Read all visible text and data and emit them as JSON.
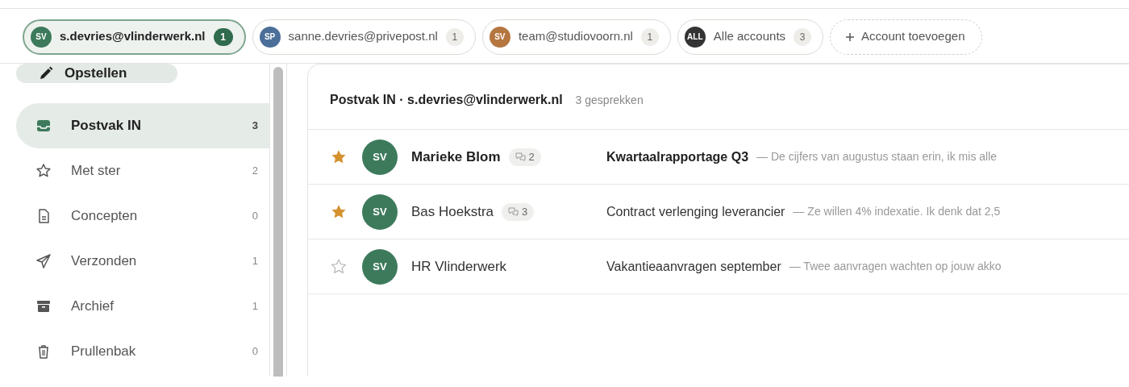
{
  "accounts": [
    {
      "initials": "SV",
      "label": "s.devries@vlinderwerk.nl",
      "count": "1",
      "color": "#3d7a5c",
      "selected": true
    },
    {
      "initials": "SP",
      "label": "sanne.devries@privepost.nl",
      "count": "1",
      "color": "#4b6f98",
      "selected": false
    },
    {
      "initials": "SV",
      "label": "team@studiovoorn.nl",
      "count": "1",
      "color": "#b5763f",
      "selected": false
    },
    {
      "initials": "ALL",
      "label": "Alle accounts",
      "count": "3",
      "color": "#333333",
      "selected": false
    }
  ],
  "add_account": {
    "label": "Account toevoegen"
  },
  "compose": {
    "label": "Opstellen"
  },
  "folders": [
    {
      "label": "Postvak IN",
      "count": "3",
      "selected": true
    },
    {
      "label": "Met ster",
      "count": "2",
      "selected": false
    },
    {
      "label": "Concepten",
      "count": "0",
      "selected": false
    },
    {
      "label": "Verzonden",
      "count": "1",
      "selected": false
    },
    {
      "label": "Archief",
      "count": "1",
      "selected": false
    },
    {
      "label": "Prullenbak",
      "count": "0",
      "selected": false
    }
  ],
  "list": {
    "title": "Postvak IN · s.devries@vlinderwerk.nl",
    "count": "3 gesprekken"
  },
  "messages": [
    {
      "starred": true,
      "initials": "SV",
      "sender": "Marieke Blom",
      "unread": true,
      "thread_count": "2",
      "subject": "Kwartaalrapportage Q3",
      "preview": "— De cijfers van augustus staan erin, ik mis alle"
    },
    {
      "starred": true,
      "initials": "SV",
      "sender": "Bas Hoekstra",
      "unread": false,
      "thread_count": "3",
      "subject": "Contract verlenging leverancier",
      "preview": "— Ze willen 4% indexatie. Ik denk dat 2,5"
    },
    {
      "starred": false,
      "initials": "SV",
      "sender": "HR Vlinderwerk",
      "unread": false,
      "subject": "Vakantieaanvragen september",
      "preview": "— Twee aanvragen wachten op jouw akko"
    }
  ]
}
